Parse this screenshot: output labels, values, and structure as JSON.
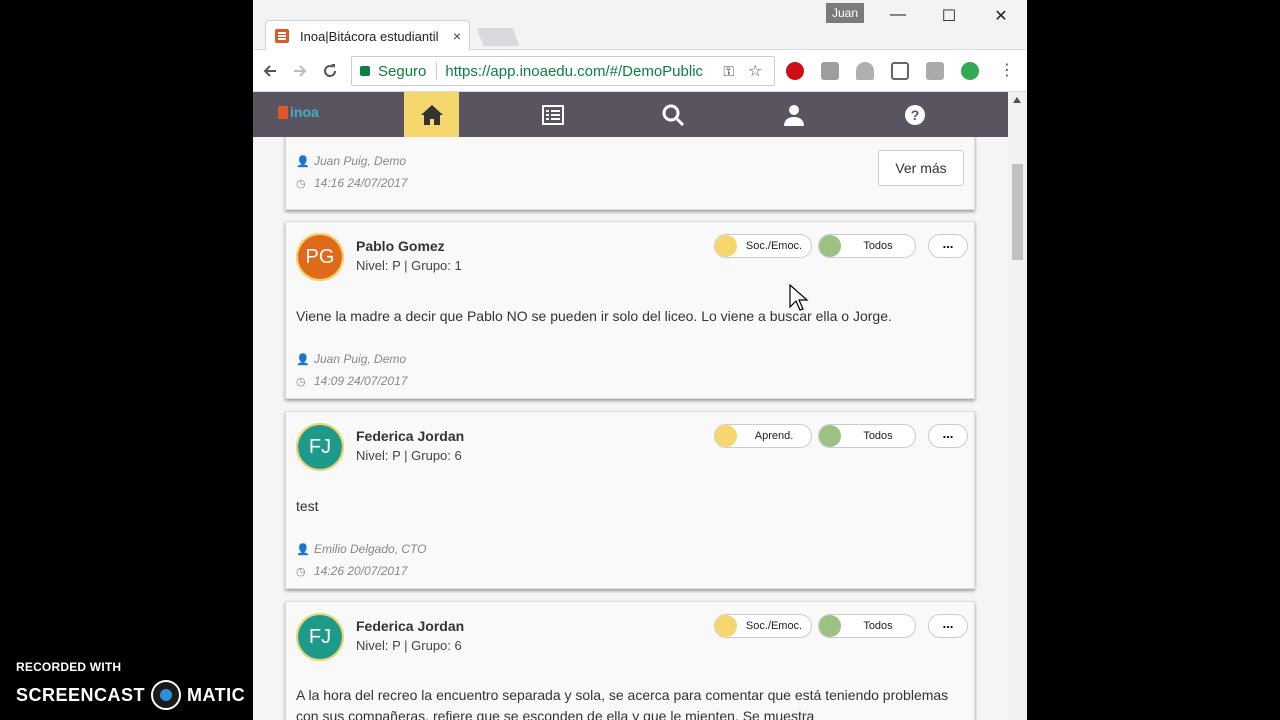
{
  "watermark": {
    "line1": "RECORDED WITH",
    "line2a": "SCREENCAST",
    "line2b": "MATIC"
  },
  "browser": {
    "tab_title": "Inoa|Bitácora estudiantil",
    "tab_close": "×",
    "user": "Juan",
    "minimize": "—",
    "maximize": "☐",
    "close": "✕",
    "secure_label": "Seguro",
    "url": "https://app.inoaedu.com/#/DemoPublic"
  },
  "app": {
    "logo_text": "inoa",
    "colors": {
      "nav_bg": "#5a5461",
      "active": "#f5d76e"
    }
  },
  "cards": [
    {
      "author": "Juan Puig, Demo",
      "time": "14:16 24/07/2017",
      "button": "Ver más"
    },
    {
      "initials": "PG",
      "avatar_color": "#e06a1a",
      "name": "Pablo Gomez",
      "nivel": "Nivel: P | Grupo: 1",
      "tag1": "Soc./Emoc.",
      "tag2": "Todos",
      "more": "...",
      "text": "Viene la madre a decir que Pablo NO se pueden ir solo del liceo. Lo viene a buscar ella o Jorge.",
      "author": "Juan Puig, Demo",
      "time": "14:09 24/07/2017"
    },
    {
      "initials": "FJ",
      "avatar_color": "#1d9a8a",
      "name": "Federica Jordan",
      "nivel": "Nivel: P | Grupo: 6",
      "tag1": "Aprend.",
      "tag2": "Todos",
      "more": "...",
      "text": "test",
      "author": "Emilio Delgado, CTO",
      "time": "14:26 20/07/2017"
    },
    {
      "initials": "FJ",
      "avatar_color": "#1d9a8a",
      "name": "Federica Jordan",
      "nivel": "Nivel: P | Grupo: 6",
      "tag1": "Soc./Emoc.",
      "tag2": "Todos",
      "more": "...",
      "text": "A la hora del recreo la encuentro separada y sola, se acerca para comentar que está teniendo problemas con sus compañeras, refiere que se esconden de ella y que le mienten. Se muestra"
    }
  ]
}
